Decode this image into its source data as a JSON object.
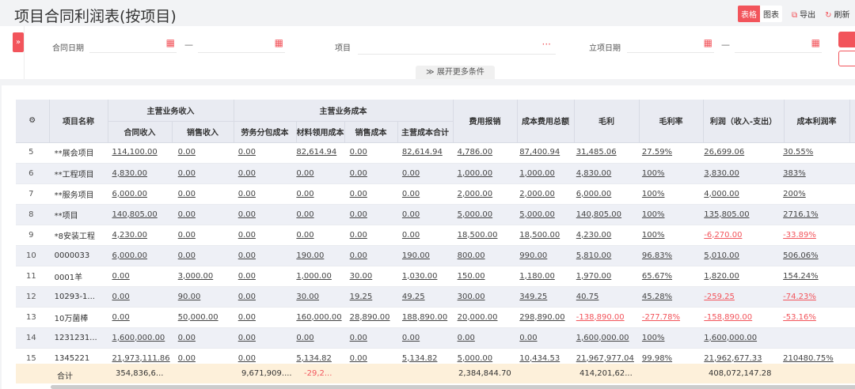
{
  "title": "项目合同利润表(按项目)",
  "toolbar": {
    "view_table": "表格",
    "view_chart": "图表",
    "export": "导出",
    "refresh": "刷新"
  },
  "filters": {
    "contract_date": "合同日期",
    "project": "项目",
    "setup_date": "立项日期",
    "dash": "—",
    "more": "展开更多条件",
    "more_icon": "chevrons-down"
  },
  "colors": {
    "accent": "#f2545b",
    "negative": "#f2545b",
    "total_bg": "#fdf0da"
  },
  "headers": {
    "name": "项目名称",
    "group_income": "主营业务收入",
    "group_cost": "主营业务成本",
    "contract_income": "合同收入",
    "sales_income": "销售收入",
    "labor_cost": "劳务分包成本",
    "material_cost": "材料领用成本",
    "sales_cost": "销售成本",
    "main_cost_total": "主营成本合计",
    "expense": "费用报销",
    "total_cost": "成本费用总额",
    "gross": "毛利",
    "gross_rate": "毛利率",
    "profit": "利润（收入-支出）",
    "cost_profit_rate": "成本利润率"
  },
  "rows": [
    {
      "idx": "5",
      "name": "**展会项目",
      "c": [
        "114,100.00",
        "0.00",
        "0.00",
        "82,614.94",
        "0.00",
        "82,614.94",
        "4,786.00",
        "87,400.94",
        "31,485.06",
        "27.59%",
        "26,699.06",
        "30.55%"
      ],
      "neg": []
    },
    {
      "idx": "6",
      "name": "**工程项目",
      "c": [
        "4,830.00",
        "0.00",
        "0.00",
        "0.00",
        "0.00",
        "0.00",
        "1,000.00",
        "1,000.00",
        "4,830.00",
        "100%",
        "3,830.00",
        "383%"
      ],
      "neg": []
    },
    {
      "idx": "7",
      "name": "**服务项目",
      "c": [
        "6,000.00",
        "0.00",
        "0.00",
        "0.00",
        "0.00",
        "0.00",
        "2,000.00",
        "2,000.00",
        "6,000.00",
        "100%",
        "4,000.00",
        "200%"
      ],
      "neg": []
    },
    {
      "idx": "8",
      "name": "**项目",
      "c": [
        "140,805.00",
        "0.00",
        "0.00",
        "0.00",
        "0.00",
        "0.00",
        "5,000.00",
        "5,000.00",
        "140,805.00",
        "100%",
        "135,805.00",
        "2716.1%"
      ],
      "neg": []
    },
    {
      "idx": "9",
      "name": "*8安装工程",
      "c": [
        "4,230.00",
        "0.00",
        "0.00",
        "0.00",
        "0.00",
        "0.00",
        "18,500.00",
        "18,500.00",
        "4,230.00",
        "100%",
        "-6,270.00",
        "-33.89%"
      ],
      "neg": [
        10,
        11
      ]
    },
    {
      "idx": "10",
      "name": "0000033",
      "c": [
        "6,000.00",
        "0.00",
        "0.00",
        "190.00",
        "0.00",
        "190.00",
        "800.00",
        "990.00",
        "5,810.00",
        "96.83%",
        "5,010.00",
        "506.06%"
      ],
      "neg": []
    },
    {
      "idx": "11",
      "name": "0001羊",
      "c": [
        "0.00",
        "3,000.00",
        "0.00",
        "1,000.00",
        "30.00",
        "1,030.00",
        "150.00",
        "1,180.00",
        "1,970.00",
        "65.67%",
        "1,820.00",
        "154.24%"
      ],
      "neg": []
    },
    {
      "idx": "12",
      "name": "10293-1...",
      "c": [
        "0.00",
        "90.00",
        "0.00",
        "30.00",
        "19.25",
        "49.25",
        "300.00",
        "349.25",
        "40.75",
        "45.28%",
        "-259.25",
        "-74.23%"
      ],
      "neg": [
        10,
        11
      ]
    },
    {
      "idx": "13",
      "name": "10万菌棒",
      "c": [
        "0.00",
        "50,000.00",
        "0.00",
        "160,000.00",
        "28,890.00",
        "188,890.00",
        "20,000.00",
        "298,890.00",
        "-138,890.00",
        "-277.78%",
        "-158,890.00",
        "-53.16%"
      ],
      "neg": [
        8,
        9,
        10,
        11
      ]
    },
    {
      "idx": "14",
      "name": "1231231...",
      "c": [
        "1,600,000.00",
        "0.00",
        "0.00",
        "0.00",
        "0.00",
        "0.00",
        "0.00",
        "0.00",
        "1,600,000.00",
        "100%",
        "1,600,000.00",
        ""
      ],
      "neg": []
    },
    {
      "idx": "15",
      "name": "1345221",
      "c": [
        "21,973,111.86",
        "0.00",
        "0.00",
        "5,134.82",
        "0.00",
        "5,134.82",
        "5,000.00",
        "10,434.53",
        "21,967,977.04",
        "99.98%",
        "21,962,677.33",
        "210480.75%"
      ],
      "neg": []
    }
  ],
  "total": {
    "label": "合计",
    "contract_income": "354,836,6...",
    "labor_cost": "9,671,909....",
    "material_cost": "-29,2...",
    "expense": "2,384,844.70",
    "gross": "414,201,62...",
    "profit": "408,072,147.28"
  }
}
